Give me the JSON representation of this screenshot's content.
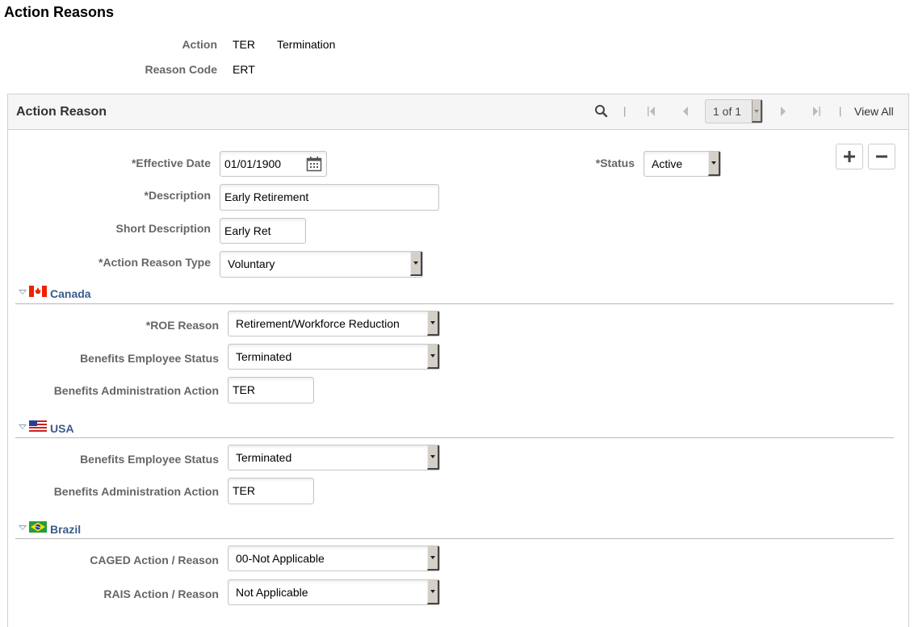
{
  "page": {
    "title": "Action Reasons"
  },
  "header_fields": {
    "action_label": "Action",
    "action_code": "TER",
    "action_desc": "Termination",
    "reason_code_label": "Reason Code",
    "reason_code": "ERT"
  },
  "panel": {
    "title": "Action Reason",
    "nav": {
      "search_icon": "search-icon",
      "separator": "|",
      "first_icon": "first-page-icon",
      "prev_icon": "previous-icon",
      "pager_text": "1 of 1",
      "next_icon": "next-icon",
      "last_icon": "last-page-icon",
      "view_all": "View All"
    },
    "add_row_label": "+",
    "delete_row_label": "−"
  },
  "form": {
    "effective_date": {
      "label": "*Effective Date",
      "value": "01/01/1900"
    },
    "status": {
      "label": "*Status",
      "value": "Active"
    },
    "description": {
      "label": "*Description",
      "value": "Early Retirement"
    },
    "short_description": {
      "label": "Short Description",
      "value": "Early Ret"
    },
    "action_reason_type": {
      "label": "*Action Reason Type",
      "value": "Voluntary"
    }
  },
  "sections": {
    "canada": {
      "name": "Canada",
      "roe_reason": {
        "label": "*ROE Reason",
        "value": "Retirement/Workforce Reduction"
      },
      "benefits_employee_status": {
        "label": "Benefits Employee Status",
        "value": "Terminated"
      },
      "benefits_admin_action": {
        "label": "Benefits Administration Action",
        "value": "TER"
      }
    },
    "usa": {
      "name": "USA",
      "benefits_employee_status": {
        "label": "Benefits Employee Status",
        "value": "Terminated"
      },
      "benefits_admin_action": {
        "label": "Benefits Administration Action",
        "value": "TER"
      }
    },
    "brazil": {
      "name": "Brazil",
      "caged": {
        "label": "CAGED Action / Reason",
        "value": "00-Not Applicable"
      },
      "rais": {
        "label": "RAIS Action / Reason",
        "value": "Not Applicable"
      }
    }
  },
  "colors": {
    "section_link": "#3b5c8c",
    "label_gray": "#666666",
    "panel_header_bg": "#f6f6f6"
  }
}
